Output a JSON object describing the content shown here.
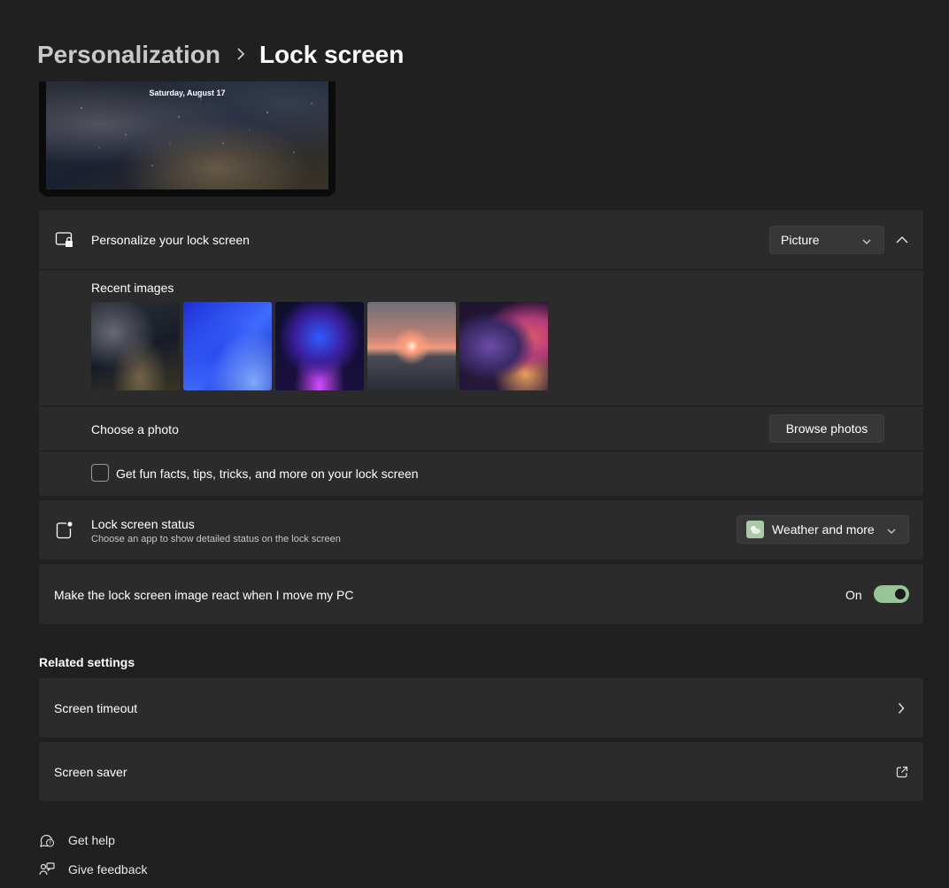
{
  "breadcrumb": {
    "parent": "Personalization",
    "current": "Lock screen"
  },
  "preview": {
    "date": "Saturday, August 17"
  },
  "personalize": {
    "label": "Personalize your lock screen",
    "dropdown_value": "Picture",
    "recent_images_label": "Recent images",
    "recent_images": [
      "night-sky",
      "blue-bloom",
      "purple-orb",
      "sunset-lake",
      "purple-ribbon"
    ],
    "choose_photo_label": "Choose a photo",
    "browse_button": "Browse photos",
    "fun_facts_label": "Get fun facts, tips, tricks, and more on your lock screen",
    "fun_facts_checked": false
  },
  "status": {
    "label": "Lock screen status",
    "description": "Choose an app to show detailed status on the lock screen",
    "dropdown_value": "Weather and more"
  },
  "motion": {
    "label": "Make the lock screen image react when I move my PC",
    "toggle_state": "On",
    "enabled": true
  },
  "related": {
    "title": "Related settings",
    "screen_timeout": "Screen timeout",
    "screen_saver": "Screen saver"
  },
  "footer": {
    "help": "Get help",
    "feedback": "Give feedback"
  },
  "colors": {
    "background": "#202020",
    "card": "#2b2b2b",
    "accent_toggle": "#99c49a"
  }
}
